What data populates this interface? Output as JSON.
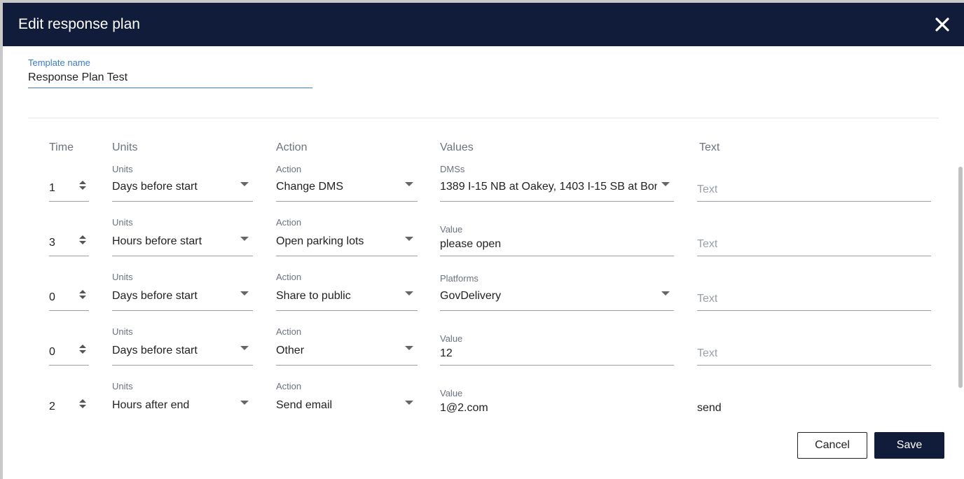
{
  "dialog": {
    "title": "Edit response plan",
    "close_icon": "close-icon"
  },
  "template": {
    "label": "Template name",
    "value": "Response Plan Test"
  },
  "columns": {
    "time": "Time",
    "units": "Units",
    "action": "Action",
    "values": "Values",
    "text": "Text"
  },
  "rows": [
    {
      "time": "1",
      "units_label": "Units",
      "units": "Days before start",
      "action_label": "Action",
      "action": "Change DMS",
      "value_label": "DMSs",
      "value": "1389 I-15 NB at Oakey, 1403 I-15 SB at Bon...",
      "text": "",
      "text_placeholder": "Text"
    },
    {
      "time": "3",
      "units_label": "Units",
      "units": "Hours before start",
      "action_label": "Action",
      "action": "Open parking lots",
      "value_label": "Value",
      "value": "please open",
      "text": "",
      "text_placeholder": "Text"
    },
    {
      "time": "0",
      "units_label": "Units",
      "units": "Days before start",
      "action_label": "Action",
      "action": "Share to public",
      "value_label": "Platforms",
      "value": "GovDelivery",
      "text": "",
      "text_placeholder": "Text"
    },
    {
      "time": "0",
      "units_label": "Units",
      "units": "Days before start",
      "action_label": "Action",
      "action": "Other",
      "value_label": "Value",
      "value": "12",
      "text": "",
      "text_placeholder": "Text"
    },
    {
      "time": "2",
      "units_label": "Units",
      "units": "Hours after end",
      "action_label": "Action",
      "action": "Send email",
      "value_label": "Value",
      "value": "1@2.com",
      "text": "send",
      "text_placeholder": ""
    }
  ],
  "buttons": {
    "cancel": "Cancel",
    "save": "Save"
  },
  "colors": {
    "header_bg": "#101c3a",
    "accent": "#3a7bc8"
  }
}
